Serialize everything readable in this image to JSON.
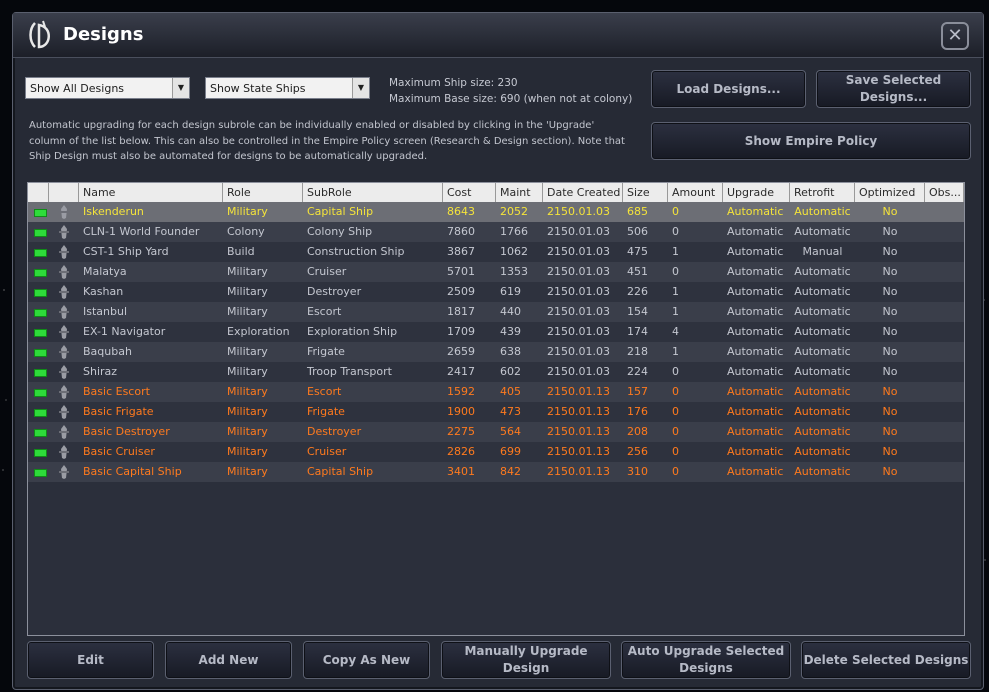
{
  "window": {
    "title": "Designs"
  },
  "filters": {
    "design_filter": "Show All Designs",
    "ship_filter": "Show State Ships"
  },
  "info": {
    "max_ship": "Maximum Ship size: 230",
    "max_base": "Maximum Base size: 690 (when not at colony)"
  },
  "description": "Automatic upgrading for each design subrole can be individually enabled or disabled by clicking in the 'Upgrade' column of the list below. This can also be controlled in the Empire Policy screen (Research & Design section). Note that Ship Design must also be automated for designs to be automatically upgraded.",
  "buttons": {
    "load": "Load Designs...",
    "save": "Save Selected Designs...",
    "policy": "Show Empire Policy",
    "edit": "Edit",
    "add": "Add New",
    "copy": "Copy As New",
    "manual": "Manually Upgrade Design",
    "auto": "Auto Upgrade Selected Designs",
    "delete": "Delete Selected Designs"
  },
  "columns": [
    "Name",
    "Role",
    "SubRole",
    "Cost",
    "Maint",
    "Date Created",
    "Size",
    "Amount",
    "Upgrade",
    "Retrofit",
    "Optimized",
    "Obs..."
  ],
  "rows": [
    [
      "Iskenderun",
      "Military",
      "Capital Ship",
      "8643",
      "2052",
      "2150.01.03",
      "685",
      "0",
      "Automatic",
      "Automatic",
      "No"
    ],
    [
      "CLN-1 World Founder",
      "Colony",
      "Colony Ship",
      "7860",
      "1766",
      "2150.01.03",
      "506",
      "0",
      "Automatic",
      "Automatic",
      "No"
    ],
    [
      "CST-1 Ship Yard",
      "Build",
      "Construction Ship",
      "3867",
      "1062",
      "2150.01.03",
      "475",
      "1",
      "Automatic",
      "Manual",
      "No"
    ],
    [
      "Malatya",
      "Military",
      "Cruiser",
      "5701",
      "1353",
      "2150.01.03",
      "451",
      "0",
      "Automatic",
      "Automatic",
      "No"
    ],
    [
      "Kashan",
      "Military",
      "Destroyer",
      "2509",
      "619",
      "2150.01.03",
      "226",
      "1",
      "Automatic",
      "Automatic",
      "No"
    ],
    [
      "Istanbul",
      "Military",
      "Escort",
      "1817",
      "440",
      "2150.01.03",
      "154",
      "1",
      "Automatic",
      "Automatic",
      "No"
    ],
    [
      "EX-1 Navigator",
      "Exploration",
      "Exploration Ship",
      "1709",
      "439",
      "2150.01.03",
      "174",
      "4",
      "Automatic",
      "Automatic",
      "No"
    ],
    [
      "Baqubah",
      "Military",
      "Frigate",
      "2659",
      "638",
      "2150.01.03",
      "218",
      "1",
      "Automatic",
      "Automatic",
      "No"
    ],
    [
      "Shiraz",
      "Military",
      "Troop Transport",
      "2417",
      "602",
      "2150.01.03",
      "224",
      "0",
      "Automatic",
      "Automatic",
      "No"
    ],
    [
      "Basic Escort",
      "Military",
      "Escort",
      "1592",
      "405",
      "2150.01.13",
      "157",
      "0",
      "Automatic",
      "Automatic",
      "No"
    ],
    [
      "Basic Frigate",
      "Military",
      "Frigate",
      "1900",
      "473",
      "2150.01.13",
      "176",
      "0",
      "Automatic",
      "Automatic",
      "No"
    ],
    [
      "Basic Destroyer",
      "Military",
      "Destroyer",
      "2275",
      "564",
      "2150.01.13",
      "208",
      "0",
      "Automatic",
      "Automatic",
      "No"
    ],
    [
      "Basic Cruiser",
      "Military",
      "Cruiser",
      "2826",
      "699",
      "2150.01.13",
      "256",
      "0",
      "Automatic",
      "Automatic",
      "No"
    ],
    [
      "Basic Capital Ship",
      "Military",
      "Capital Ship",
      "3401",
      "842",
      "2150.01.13",
      "310",
      "0",
      "Automatic",
      "Automatic",
      "No"
    ]
  ],
  "colors": {
    "white_text": "#c4c7d0",
    "orange_text": "#ff7a1e",
    "yellow_text": "#f5e43a",
    "status_green": "#2edc3a"
  }
}
